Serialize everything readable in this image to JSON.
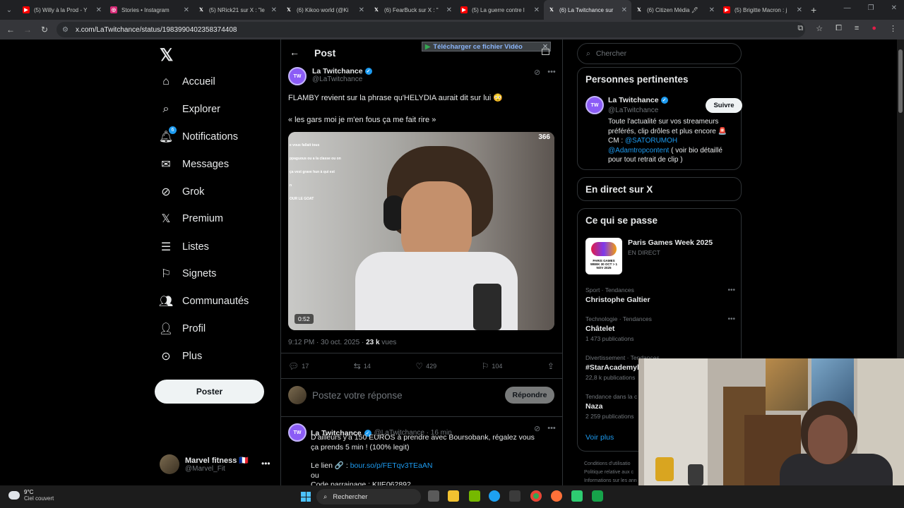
{
  "browser": {
    "tabs": [
      {
        "title": "(5) Willy à la Prod - Y",
        "color": "#ff0000"
      },
      {
        "title": "Stories • Instagram",
        "color": "#d62976"
      },
      {
        "title": "(5) NRick21 sur X : \"le",
        "color": "#000000"
      },
      {
        "title": "(6) Kikoo world (@Ki",
        "color": "#000000"
      },
      {
        "title": "(6) FearBuck sur X : \"",
        "color": "#000000"
      },
      {
        "title": "(5) La guerre contre l",
        "color": "#ff0000"
      },
      {
        "title": "(6) La Twitchance sur",
        "color": "#000000",
        "active": true
      },
      {
        "title": "(6) Citizen Média 🖋",
        "color": "#000000"
      },
      {
        "title": "(5) Brigitte Macron : j",
        "color": "#ff0000"
      }
    ],
    "url": "x.com/LaTwitchance/status/1983990402358374408"
  },
  "left_nav": {
    "items": [
      {
        "label": "Accueil",
        "icon": "home-icon"
      },
      {
        "label": "Explorer",
        "icon": "search-icon"
      },
      {
        "label": "Notifications",
        "icon": "bell-icon",
        "badge": "6"
      },
      {
        "label": "Messages",
        "icon": "mail-icon"
      },
      {
        "label": "Grok",
        "icon": "grok-icon"
      },
      {
        "label": "Premium",
        "icon": "x-icon"
      },
      {
        "label": "Listes",
        "icon": "list-icon"
      },
      {
        "label": "Signets",
        "icon": "bookmark-icon"
      },
      {
        "label": "Communautés",
        "icon": "people-icon"
      },
      {
        "label": "Profil",
        "icon": "person-icon"
      },
      {
        "label": "Plus",
        "icon": "more-circle-icon"
      }
    ],
    "post_button": "Poster",
    "account": {
      "name": "Marvel fitness 🇫🇷",
      "handle": "@Marvel_Fit"
    }
  },
  "post": {
    "header_title": "Post",
    "download_banner": "Télécharger ce fichier Vidéo",
    "author": {
      "name": "La Twitchance",
      "handle": "@LaTwitchance"
    },
    "text_line1": "FLAMBY revient sur la phrase qu'HELYDIA aurait dit sur lui 😳",
    "text_line2": "« les gars moi je m'en fous ça me fait rire »",
    "media": {
      "views": "366",
      "duration": "0:52",
      "overlay_lines": [
        "e vous fallait tous",
        "ppaguous ou a la classe ou on",
        "ça vest grave hun à qui est",
        "n",
        "OUR LE GOAT"
      ]
    },
    "time": "9:12 PM · 30 oct. 2025 · ",
    "views_count": "23 k",
    "views_label": " vues",
    "stats": {
      "replies": "17",
      "reposts": "14",
      "likes": "429",
      "bookmarks": "104"
    },
    "reply_placeholder": "Postez votre réponse",
    "reply_button": "Répondre"
  },
  "reply_tweet": {
    "author": "La Twitchance",
    "handle_time": "@LaTwitchance · 16 min",
    "line1": "D'ailleurs y'a 150 EUROS à prendre avec Boursobank, régalez vous ça prends 5 min ! (100% legit)",
    "line2": "Le lien 🔗 : ",
    "link": "bour.so/p/FETqv3TEaAN",
    "line3": "ou",
    "line4": "Code parrainage : KIIE062892"
  },
  "right": {
    "search_placeholder": "Chercher",
    "relevant": {
      "title": "Personnes pertinentes",
      "name": "La Twitchance",
      "handle": "@LaTwitchance",
      "follow": "Suivre",
      "bio1": "Toute l'actualité sur vos streameurs préférés, clip drôles et plus encore 🚨 CM : ",
      "bio_link1": "@SATORUMOH",
      "bio_link2": "@Adamtropcontent",
      "bio2": " ( voir bio détaillé pour tout retrait de clip )"
    },
    "live_title": "En direct sur X",
    "happening": {
      "title": "Ce qui se passe",
      "event": {
        "name": "Paris Games Week 2025",
        "status": "EN DIRECT",
        "img_text": "PARIS GAMES WEEK 30 OCT > 1 NOV 2025"
      },
      "trends": [
        {
          "category": "Sport · Tendances",
          "title": "Christophe Galtier",
          "count": ""
        },
        {
          "category": "Technologie · Tendances",
          "title": "Châtelet",
          "count": "1 473 publications"
        },
        {
          "category": "Divertissement · Tendances",
          "title": "#StarAcademyl",
          "count": "22,8 k publications"
        },
        {
          "category": "Tendance dans la c",
          "title": "Naza",
          "count": "2 259 publications"
        }
      ],
      "see_more": "Voir plus"
    },
    "footer": [
      "Conditions d'utilisatio",
      "Politique relative aux c",
      "Informations sur les ann"
    ]
  },
  "taskbar": {
    "temp": "9°C",
    "weather": "Ciel couvert",
    "search": "Rechercher"
  }
}
